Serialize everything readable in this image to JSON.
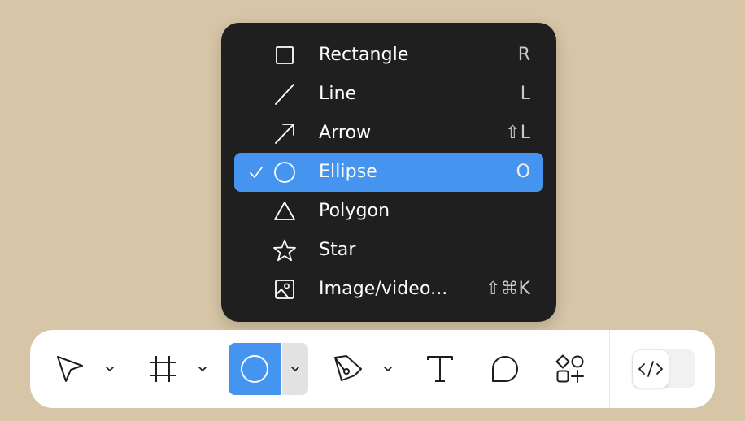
{
  "menu": {
    "items": [
      {
        "label": "Rectangle",
        "shortcut": "R",
        "icon": "rectangle-icon",
        "selected": false
      },
      {
        "label": "Line",
        "shortcut": "L",
        "icon": "line-icon",
        "selected": false
      },
      {
        "label": "Arrow",
        "shortcut": "⇧L",
        "icon": "arrow-icon",
        "selected": false
      },
      {
        "label": "Ellipse",
        "shortcut": "O",
        "icon": "ellipse-icon",
        "selected": true
      },
      {
        "label": "Polygon",
        "shortcut": "",
        "icon": "polygon-icon",
        "selected": false
      },
      {
        "label": "Star",
        "shortcut": "",
        "icon": "star-icon",
        "selected": false
      },
      {
        "label": "Image/video...",
        "shortcut": "⇧⌘K",
        "icon": "image-icon",
        "selected": false
      }
    ]
  },
  "toolbar": {
    "tools": [
      {
        "name": "move-tool",
        "icon": "cursor-icon",
        "has_menu": true
      },
      {
        "name": "frame-tool",
        "icon": "frame-icon",
        "has_menu": true
      },
      {
        "name": "shape-tool",
        "icon": "ellipse-icon",
        "has_menu": true,
        "active": true
      },
      {
        "name": "pen-tool",
        "icon": "pen-icon",
        "has_menu": true
      },
      {
        "name": "text-tool",
        "icon": "text-icon",
        "has_menu": false
      },
      {
        "name": "comment-tool",
        "icon": "comment-icon",
        "has_menu": false
      },
      {
        "name": "resources-tool",
        "icon": "resources-icon",
        "has_menu": false
      }
    ],
    "dev_mode": {
      "icon": "code-icon",
      "enabled": false
    }
  },
  "colors": {
    "background": "#d7c5a7",
    "menu_bg": "#1f1f1f",
    "accent": "#4594f0",
    "toolbar_bg": "#ffffff"
  }
}
